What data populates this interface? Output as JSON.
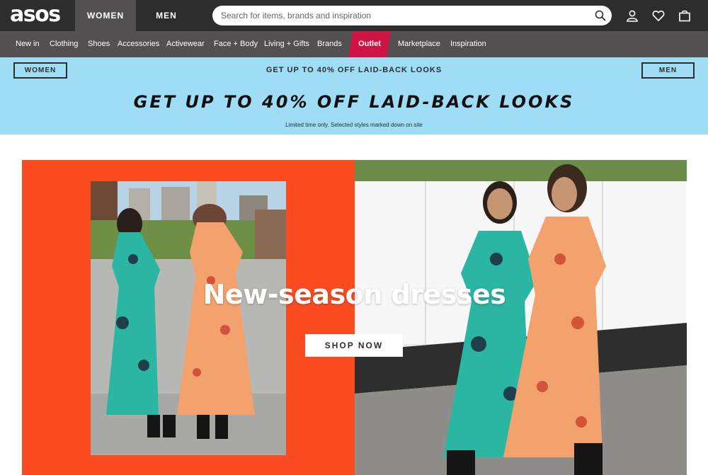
{
  "header": {
    "logo": "asos",
    "tabs": [
      {
        "label": "WOMEN",
        "active": true
      },
      {
        "label": "MEN",
        "active": false
      }
    ],
    "search_placeholder": "Search for items, brands and inspiration",
    "icons": [
      "search-icon",
      "account-icon",
      "heart-icon",
      "bag-icon"
    ]
  },
  "nav": {
    "items": [
      "New in",
      "Clothing",
      "Shoes",
      "Accessories",
      "Activewear",
      "Face + Body",
      "Living + Gifts",
      "Brands",
      "Outlet",
      "Marketplace",
      "Inspiration"
    ],
    "highlight": "Outlet",
    "highlight_color": "#d01345"
  },
  "promo_strip": {
    "women_label": "WOMEN",
    "message": "GET UP TO 40% OFF LAID-BACK LOOKS",
    "men_label": "MEN"
  },
  "banner": {
    "title": "GET UP TO 40% OFF LAID-BACK LOOKS",
    "subtitle": "Limited time only. Selected styles marked down on site"
  },
  "hero": {
    "title": "New-season dresses",
    "cta_label": "SHOP NOW",
    "accent_color": "#fa4c20"
  },
  "colors": {
    "topbar": "#2d2d2d",
    "nav": "#525050",
    "promo": "#9fdcf5"
  }
}
